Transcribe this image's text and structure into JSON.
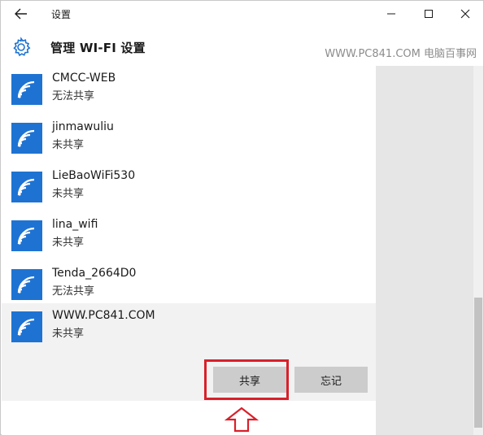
{
  "window": {
    "title": "设置"
  },
  "header": {
    "title": "管理 WI-FI 设置",
    "watermark": "WWW.PC841.COM 电脑百事网"
  },
  "networks": [
    {
      "name": "CMCC-WEB",
      "status": "无法共享"
    },
    {
      "name": "jinmawuliu",
      "status": "未共享"
    },
    {
      "name": "LieBaoWiFi530",
      "status": "未共享"
    },
    {
      "name": "lina_wifi",
      "status": "未共享"
    },
    {
      "name": "Tenda_2664D0",
      "status": "无法共享"
    },
    {
      "name": "WWW.PC841.COM",
      "status": "未共享"
    }
  ],
  "actions": {
    "share_label": "共享",
    "forget_label": "忘记"
  },
  "colors": {
    "accent": "#1e73d2",
    "highlight": "#d9202a"
  },
  "icons": [
    "back-arrow-icon",
    "minimize-icon",
    "maximize-icon",
    "close-icon",
    "gear-icon",
    "wifi-icon",
    "up-arrow-icon"
  ]
}
